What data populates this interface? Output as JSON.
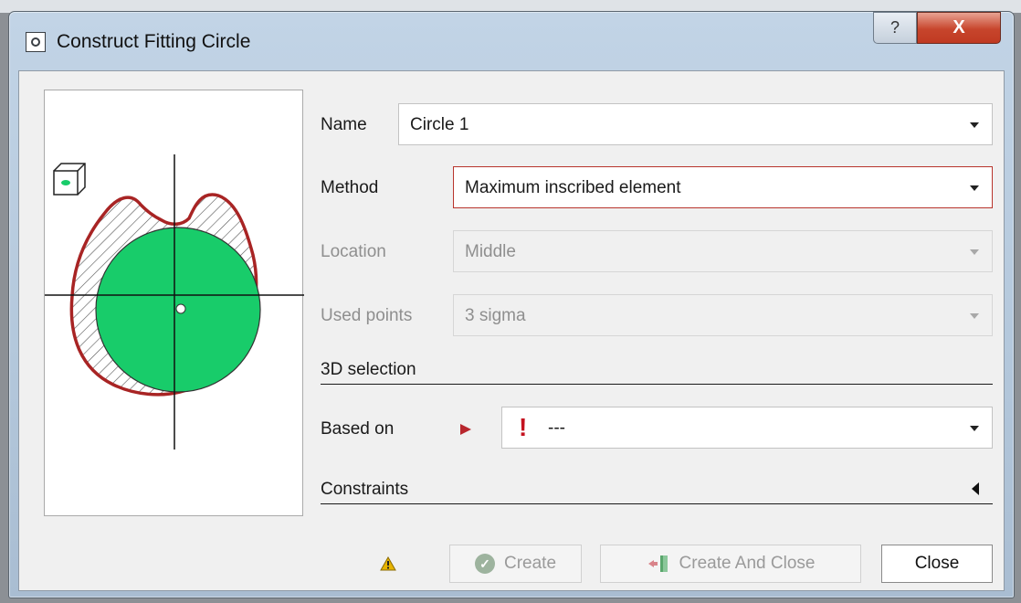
{
  "window": {
    "title": "Construct Fitting Circle",
    "help_label": "?",
    "close_label": "X"
  },
  "form": {
    "name": {
      "label": "Name",
      "value": "Circle 1"
    },
    "method": {
      "label": "Method",
      "value": "Maximum inscribed element"
    },
    "location": {
      "label": "Location",
      "value": "Middle"
    },
    "used_points": {
      "label": "Used points",
      "value": "3 sigma"
    },
    "selection_header": "3D selection",
    "based_on": {
      "label": "Based on",
      "marker": "!",
      "value": "---"
    },
    "constraints_header": "Constraints"
  },
  "buttons": {
    "create": "Create",
    "create_and_close": "Create And Close",
    "close": "Close"
  },
  "colors": {
    "error_border": "#b8342c",
    "inscribed_fill": "#18cc6a",
    "profile_stroke": "#a82424",
    "warning": "#e7b400"
  },
  "icons": {
    "title": "window-menu-icon",
    "preview_view": "3d-box-icon",
    "based_on_pointer": "red-play-arrow-icon",
    "based_on_status": "red-exclamation-icon",
    "constraints_toggle": "collapse-left-arrow-icon",
    "warning": "warning-triangle-icon",
    "create": "check-circle-icon",
    "create_and_close": "exit-door-icon"
  }
}
